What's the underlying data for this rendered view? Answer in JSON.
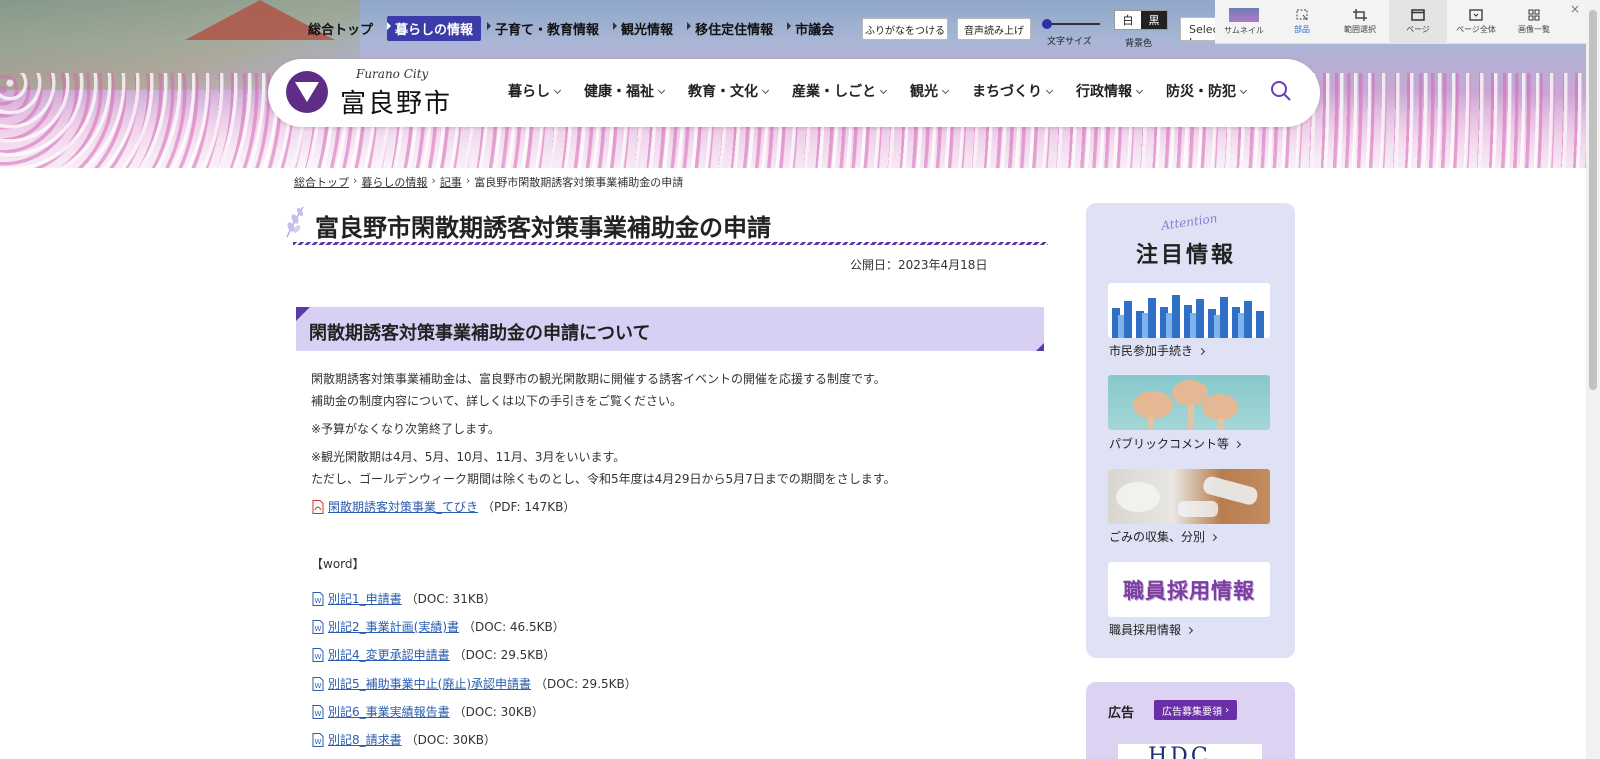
{
  "top_nav": [
    "総合トップ",
    "暮らしの情報",
    "子育て・教育情報",
    "観光情報",
    "移住定住情報",
    "市議会"
  ],
  "utility": {
    "furigana": "ふりがなをつける",
    "voice": "音声読み上げ",
    "font_size_label": "文字サイズ",
    "bg_label": "背景色",
    "white": "白",
    "black": "黒",
    "language": "Select Language"
  },
  "tool": {
    "items": [
      "サムネイル",
      "部品",
      "範囲選択",
      "ページ",
      "ページ全体",
      "画像一覧"
    ],
    "close": "×"
  },
  "logo": {
    "en": "Furano City",
    "jp": "富良野市"
  },
  "global_nav": [
    "暮らし",
    "健康・福祉",
    "教育・文化",
    "産業・しごと",
    "観光",
    "まちづくり",
    "行政情報",
    "防災・防犯"
  ],
  "breadcrumb": [
    "総合トップ",
    "暮らしの情報",
    "記事",
    "富良野市閑散期誘客対策事業補助金の申請"
  ],
  "page": {
    "title": "富良野市閑散期誘客対策事業補助金の申請",
    "published": "公開日：2023年4月18日",
    "section_title": "閑散期誘客対策事業補助金の申請について",
    "paragraphs": [
      "閑散期誘客対策事業補助金は、富良野市の観光閑散期に開催する誘客イベントの開催を応援する制度です。",
      "補助金の制度内容について、詳しくは以下の手引きをご覧ください。",
      "※予算がなくなり次第終了します。",
      "※観光閑散期は4月、5月、10月、11月、3月をいいます。",
      "ただし、ゴールデンウィーク期間は除くものとし、令和5年度は4月29日から5月7日までの期間をさします。"
    ],
    "pdf": {
      "name": "閑散期誘客対策事業_てびき",
      "size": "（PDF: 147KB）"
    },
    "word_heading": "【word】",
    "docs": [
      {
        "name": "別記1_申請書",
        "size": "（DOC: 31KB）"
      },
      {
        "name": "別記2_事業計画(実績)書",
        "size": "（DOC: 46.5KB）"
      },
      {
        "name": "別記4_変更承認申請書",
        "size": "（DOC: 29.5KB）"
      },
      {
        "name": "別記5_補助事業中止(廃止)承認申請書",
        "size": "（DOC: 29.5KB）"
      },
      {
        "name": "別記6_事業実績報告書",
        "size": "（DOC: 30KB）"
      },
      {
        "name": "別記8_請求書",
        "size": "（DOC: 30KB）"
      }
    ]
  },
  "sidebar": {
    "attention": "Attention",
    "title": "注目情報",
    "cards": [
      "市民参加手続き",
      "パブリックコメント等",
      "ごみの収集、分別",
      "職員採用情報"
    ],
    "recruit_banner": "職員採用情報"
  },
  "ad": {
    "label": "広告",
    "button": "広告募集要領",
    "banner": "HDC"
  },
  "colors": {
    "accent": "#5b3aa8",
    "nav_active": "#3c3ca8",
    "section_bg": "#d8d0f4",
    "link": "#2a5db0"
  }
}
